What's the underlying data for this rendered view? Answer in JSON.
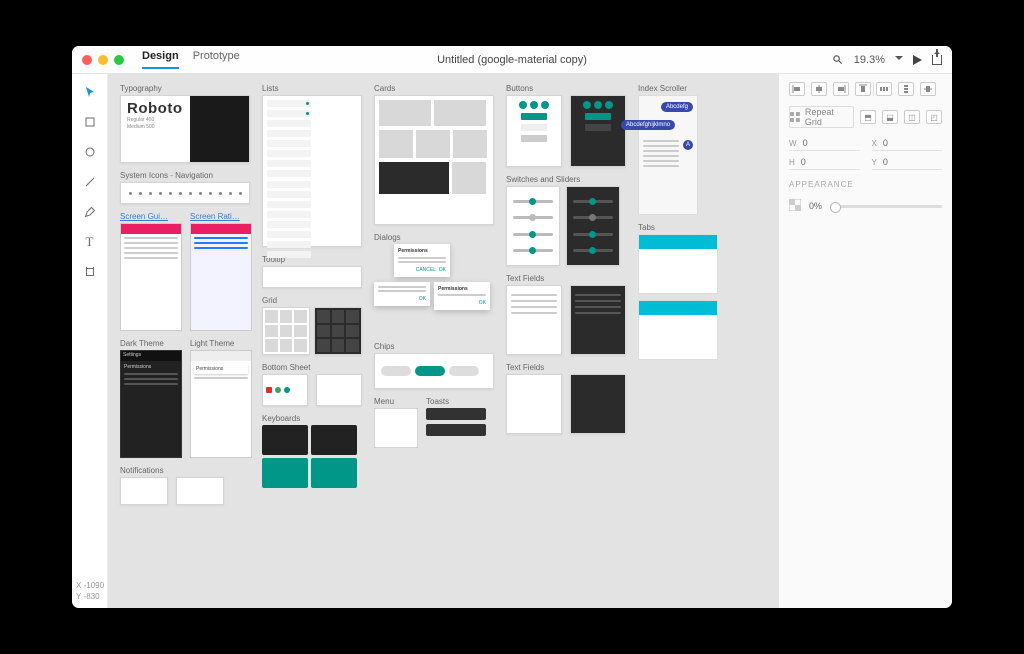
{
  "tabs": {
    "design": "Design",
    "prototype": "Prototype"
  },
  "doc_title": "Untitled (google-material copy)",
  "zoom": "19.3%",
  "coords": {
    "x_label": "X",
    "x_value": "-1090",
    "y_label": "Y",
    "y_value": "-830"
  },
  "artboards": {
    "typography": "Typography",
    "roboto": "Roboto",
    "system_icons": "System Icons - Navigation",
    "screen_guides": "Screen Gui…",
    "screen_ratio": "Screen Rati…",
    "dark_theme": "Dark Theme",
    "light_theme": "Light Theme",
    "notifications": "Notifications",
    "lists": "Lists",
    "tooltip": "Tooltip",
    "grid": "Grid",
    "bottom_sheet": "Bottom Sheet",
    "keyboards": "Keyboards",
    "cards": "Cards",
    "dialogs": "Dialogs",
    "chips": "Chips",
    "menu": "Menu",
    "toasts": "Toasts",
    "buttons": "Buttons",
    "switches": "Switches and Sliders",
    "text_fields": "Text Fields",
    "text_fields2": "Text Fields",
    "index_scroller": "Index Scroller",
    "tabs": "Tabs",
    "bubble1": "Abcdefg",
    "bubble2": "Abcdefghijklmno",
    "permissions": "Permissions",
    "settings": "Settings"
  },
  "inspector": {
    "repeat_grid": "Repeat Grid",
    "w_label": "W",
    "w_value": "0",
    "h_label": "H",
    "h_value": "0",
    "x_label": "X",
    "x_value": "0",
    "y_label": "Y",
    "y_value": "0",
    "appearance": "APPEARANCE",
    "opacity": "0%"
  }
}
